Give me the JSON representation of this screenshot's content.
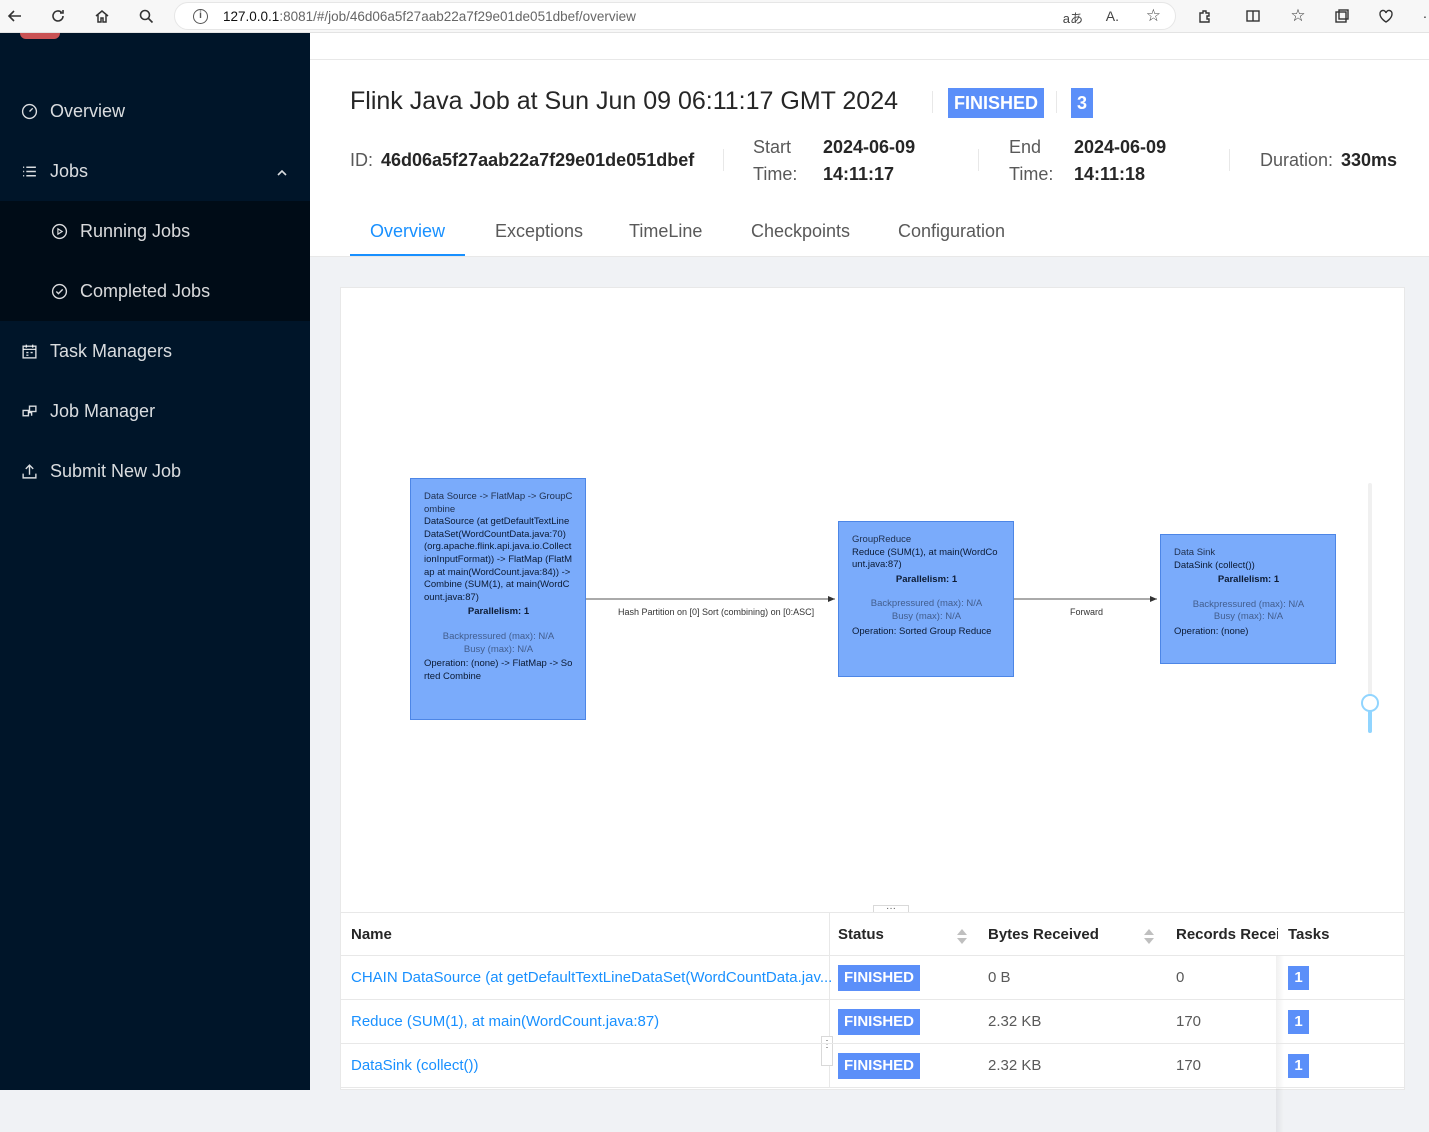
{
  "browser": {
    "url_host": "127.0.0.1",
    "url_rest": ":8081/#/job/46d06a5f27aab22a7f29e01de051dbef/overview"
  },
  "sidebar": {
    "items": [
      {
        "label": "Overview",
        "icon": "dashboard-icon"
      },
      {
        "label": "Jobs",
        "icon": "list-icon"
      },
      {
        "label": "Running Jobs",
        "icon": "play-circle-icon"
      },
      {
        "label": "Completed Jobs",
        "icon": "check-circle-icon"
      },
      {
        "label": "Task Managers",
        "icon": "schedule-icon"
      },
      {
        "label": "Job Manager",
        "icon": "build-icon"
      },
      {
        "label": "Submit New Job",
        "icon": "upload-icon"
      }
    ]
  },
  "job": {
    "title": "Flink Java Job at Sun Jun 09 06:11:17 GMT 2024",
    "status": "FINISHED",
    "task_count": "3",
    "id_label": "ID:",
    "id": "46d06a5f27aab22a7f29e01de051dbef",
    "start_label_1": "Start",
    "start_label_2": "Time:",
    "start_date": "2024-06-09",
    "start_time": "14:11:17",
    "end_label_1": "End",
    "end_label_2": "Time:",
    "end_date": "2024-06-09",
    "end_time": "14:11:18",
    "duration_label": "Duration:",
    "duration": "330ms"
  },
  "tabs": [
    {
      "label": "Overview",
      "active": true
    },
    {
      "label": "Exceptions",
      "active": false
    },
    {
      "label": "TimeLine",
      "active": false
    },
    {
      "label": "Checkpoints",
      "active": false
    },
    {
      "label": "Configuration",
      "active": false
    }
  ],
  "graph": {
    "nodes": [
      {
        "title": "Data Source -> FlatMap -> GroupCombine",
        "desc": "DataSource (at getDefaultTextLineDataSet(WordCountData.java:70) (org.apache.flink.api.java.io.CollectionInputFormat)) -> FlatMap (FlatMap at main(WordCount.java:84)) -> Combine (SUM(1), at main(WordCount.java:87)",
        "parallelism": "Parallelism: 1",
        "backpressured": "Backpressured (max): N/A",
        "busy": "Busy (max): N/A",
        "operation": "Operation: (none) -> FlatMap -> Sorted Combine"
      },
      {
        "title": "GroupReduce",
        "desc": "Reduce (SUM(1), at main(WordCount.java:87)",
        "parallelism": "Parallelism: 1",
        "backpressured": "Backpressured (max): N/A",
        "busy": "Busy (max): N/A",
        "operation": "Operation: Sorted Group Reduce"
      },
      {
        "title": "Data Sink",
        "desc": "DataSink (collect())",
        "parallelism": "Parallelism: 1",
        "backpressured": "Backpressured (max): N/A",
        "busy": "Busy (max): N/A",
        "operation": "Operation: (none)"
      }
    ],
    "edges": [
      {
        "label": "Hash Partition on [0] Sort (combining) on [0:ASC]"
      },
      {
        "label": "Forward"
      }
    ],
    "resize_handle": "···"
  },
  "table": {
    "headers": {
      "name": "Name",
      "status": "Status",
      "bytes": "Bytes Received",
      "records": "Records Received",
      "tasks": "Tasks"
    },
    "rows": [
      {
        "name": "CHAIN DataSource (at getDefaultTextLineDataSet(WordCountData.jav...",
        "status": "FINISHED",
        "bytes": "0 B",
        "records": "0",
        "tasks": "1"
      },
      {
        "name": "Reduce (SUM(1), at main(WordCount.java:87)",
        "status": "FINISHED",
        "bytes": "2.32 KB",
        "records": "170",
        "tasks": "1"
      },
      {
        "name": "DataSink (collect())",
        "status": "FINISHED",
        "bytes": "2.32 KB",
        "records": "170",
        "tasks": "1"
      }
    ]
  },
  "colors": {
    "sidebar_bg": "#001529",
    "accent": "#1890ff",
    "badge": "#5b8ff9",
    "node_fill": "#7aabfb"
  }
}
